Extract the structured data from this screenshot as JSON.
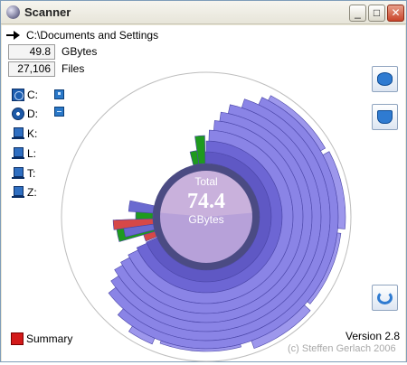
{
  "window": {
    "title": "Scanner",
    "minimize_symbol": "_",
    "maximize_symbol": "□",
    "close_symbol": "✕"
  },
  "path": {
    "icon": "arrow-right-icon",
    "text": "C:\\Documents and Settings"
  },
  "stats": {
    "size_value": "49.8",
    "size_unit": "GBytes",
    "files_value": "27,106",
    "files_unit": "Files"
  },
  "drives": [
    {
      "label": "C:",
      "icon": "hard-drive-icon"
    },
    {
      "label": "D:",
      "icon": "cd-drive-icon"
    },
    {
      "label": "K:",
      "icon": "network-drive-icon"
    },
    {
      "label": "L:",
      "icon": "network-drive-icon"
    },
    {
      "label": "T:",
      "icon": "network-drive-icon"
    },
    {
      "label": "Z:",
      "icon": "network-drive-icon"
    }
  ],
  "center": {
    "label": "Total",
    "value": "74.4",
    "unit": "GBytes"
  },
  "summary": {
    "label": "Summary"
  },
  "footer": {
    "version": "Version 2.8",
    "copyright": "(c) Steffen Gerlach 2006"
  },
  "colors": {
    "ring_purple": "#8a84e6",
    "ring_dark": "#5f58c4",
    "green": "#1e9a1e",
    "red": "#d64848",
    "center_pink": "#d6b7d9"
  }
}
